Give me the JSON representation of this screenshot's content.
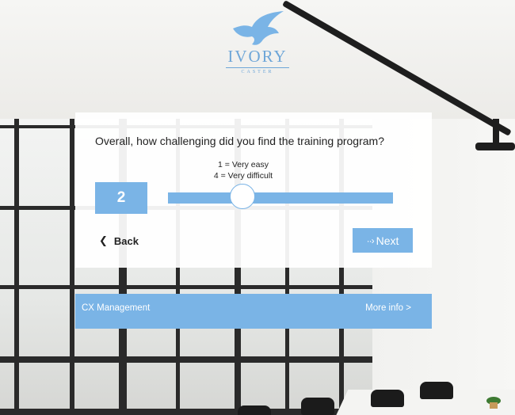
{
  "logo": {
    "word": "IVORY",
    "sub": "CASTER",
    "icon": "bird-icon",
    "color": "#6ea6d8"
  },
  "survey": {
    "question": "Overall, how challenging did you find the training program?",
    "scale_hint_low": "1 = Very easy",
    "scale_hint_high": "4 = Very difficult",
    "value": "2",
    "slider_min": 1,
    "slider_max": 4,
    "slider_value_fraction": 0.33,
    "back_label": "Back",
    "back_icon": "chevron-left-icon",
    "next_label": "Next",
    "next_icon": "arrow-right-icon"
  },
  "footer": {
    "left": "CX Management",
    "right": "More info >"
  },
  "colors": {
    "accent": "#7ab4e6",
    "card": "#ffffff"
  }
}
